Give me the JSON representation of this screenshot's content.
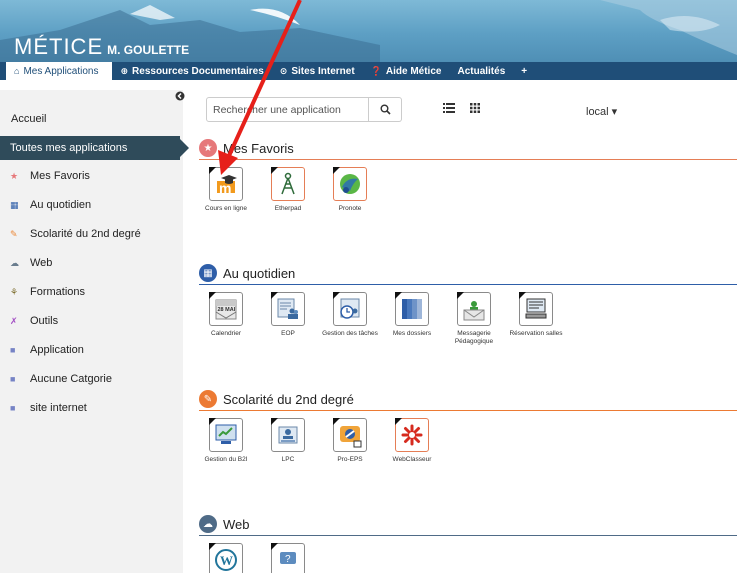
{
  "header": {
    "brand": "MÉTICE",
    "user": "M. GOULETTE",
    "nav": [
      {
        "icon": "home-icon",
        "glyph": "⌂",
        "label": "Mes Applications"
      },
      {
        "icon": "circle-plus-icon",
        "glyph": "⊕",
        "label": "Ressources Documentaires"
      },
      {
        "icon": "globe-icon",
        "glyph": "⊙",
        "label": "Sites Internet"
      },
      {
        "icon": "question-icon",
        "glyph": "❓",
        "label": "Aide Métice"
      },
      {
        "icon": "",
        "glyph": "",
        "label": "Actualités"
      },
      {
        "icon": "",
        "glyph": "",
        "label": "+"
      }
    ]
  },
  "sidebar": {
    "home": "Accueil",
    "active": "Toutes mes applications",
    "items": [
      {
        "label": "Mes Favoris",
        "icon": "star-icon",
        "glyph": "★",
        "color": "#e6787a"
      },
      {
        "label": "Au quotidien",
        "icon": "calendar-icon",
        "glyph": "▦",
        "color": "#2e5ea8"
      },
      {
        "label": "Scolarité du 2nd degré",
        "icon": "edit-icon",
        "glyph": "✎",
        "color": "#ec8a3a"
      },
      {
        "label": "Web",
        "icon": "cloud-icon",
        "glyph": "☁",
        "color": "#6a7d8e"
      },
      {
        "label": "Formations",
        "icon": "sitemap-icon",
        "glyph": "⚘",
        "color": "#7b6b2a"
      },
      {
        "label": "Outils",
        "icon": "wrench-icon",
        "glyph": "✗",
        "color": "#a34fc4"
      },
      {
        "label": "Application",
        "icon": "square-icon",
        "glyph": "■",
        "color": "#7683c5"
      },
      {
        "label": "Aucune Catgorie",
        "icon": "square-icon",
        "glyph": "■",
        "color": "#7683c5"
      },
      {
        "label": "site internet",
        "icon": "square-icon",
        "glyph": "■",
        "color": "#7683c5"
      }
    ]
  },
  "toolbar": {
    "search_placeholder": "Rechercher une application",
    "local_label": "local ▾"
  },
  "sections": [
    {
      "title": "Mes Favoris",
      "color": "#e57e56",
      "apps": [
        "Cours en ligne",
        "Etherpad",
        "Pronote"
      ]
    },
    {
      "title": "Au quotidien",
      "color": "#2e5ea8",
      "apps": [
        "Calendrier",
        "EOP",
        "Gestion des tâches",
        "Mes dossiers",
        "Messagerie Pédagogique",
        "Réservation salles"
      ]
    },
    {
      "title": "Scolarité du 2nd degré",
      "color": "#ec7a33",
      "apps": [
        "Gestion du B2I",
        "LPC",
        "Pro-EPS",
        "WebClasseur"
      ]
    },
    {
      "title": "Web",
      "color": "#4f6b87",
      "apps": [
        "",
        ""
      ]
    }
  ],
  "calendar_text": "28 MAI"
}
